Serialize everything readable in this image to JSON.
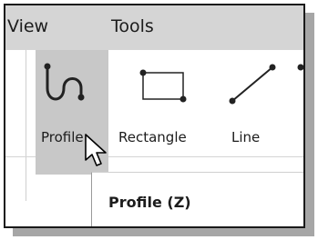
{
  "menubar": {
    "items": [
      {
        "label": "View"
      },
      {
        "label": "Tools"
      }
    ]
  },
  "ribbon": {
    "tools": [
      {
        "label": "Profile",
        "icon": "profile-icon",
        "highlighted": true
      },
      {
        "label": "Rectangle",
        "icon": "rectangle-icon",
        "highlighted": false
      },
      {
        "label": "Line",
        "icon": "line-icon",
        "highlighted": false
      }
    ]
  },
  "tooltip": {
    "text": "Profile (Z)"
  },
  "cursor": {
    "icon": "arrow-cursor-icon"
  },
  "colors": {
    "menubar": "#d5d5d5",
    "highlight": "#c8c8c8",
    "shadow": "#a6a6a6",
    "icon_stroke": "#222222"
  }
}
